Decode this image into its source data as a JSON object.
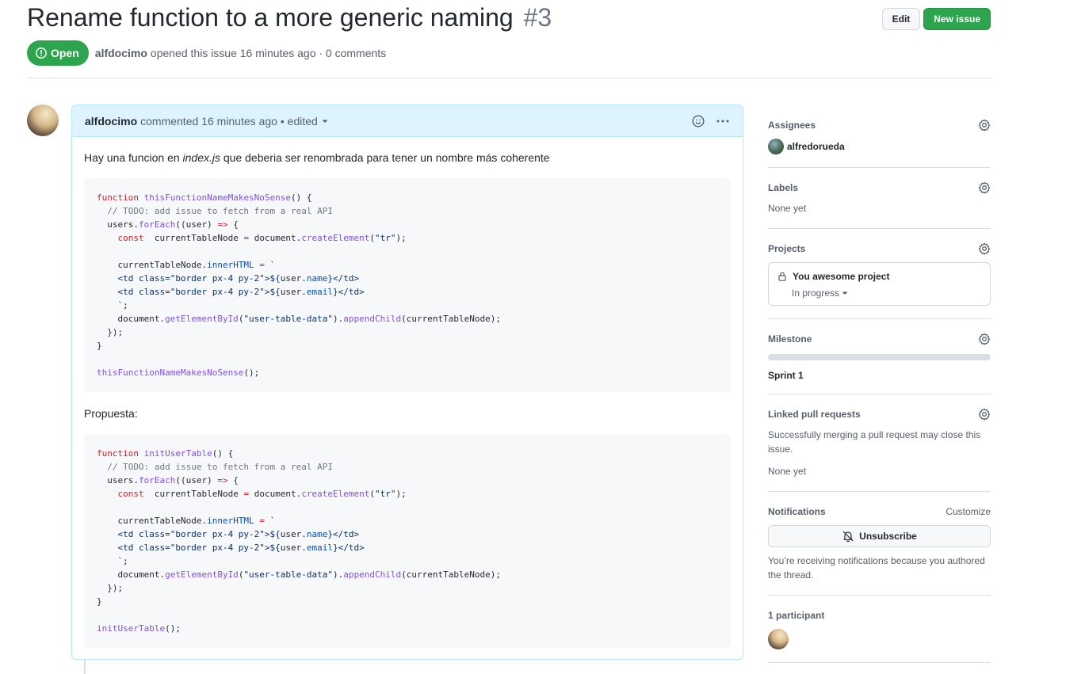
{
  "issue": {
    "title": "Rename function to a more generic naming",
    "number": "#3",
    "state": "Open",
    "author": "alfdocimo",
    "meta_text": "opened this issue 16 minutes ago · 0 comments"
  },
  "header_buttons": {
    "edit": "Edit",
    "new_issue": "New issue"
  },
  "comment": {
    "author": "alfdocimo",
    "meta": "commented 16 minutes ago",
    "edited": "• edited",
    "body_intro_1": "Hay una funcion en ",
    "body_intro_file": "index.js",
    "body_intro_2": " que deberia ser renombrada para tener un nombre más coherente",
    "proposal_label": "Propuesta:",
    "code1": [
      [
        [
          "k",
          "function "
        ],
        [
          "f",
          "thisFunctionNameMakesNoSense"
        ],
        [
          "",
          "() {"
        ]
      ],
      [
        [
          "c",
          "  // TODO: add issue to fetch from a real API"
        ]
      ],
      [
        [
          "",
          "  users."
        ],
        [
          "f",
          "forEach"
        ],
        [
          "",
          "((user) "
        ],
        [
          "k",
          "=>"
        ],
        [
          "",
          " {"
        ]
      ],
      [
        [
          "k",
          "    const "
        ],
        [
          "",
          " currentTableNode "
        ],
        [
          "k",
          "="
        ],
        [
          "",
          " document."
        ],
        [
          "f",
          "createElement"
        ],
        [
          "",
          "("
        ],
        [
          "s",
          "\"tr\""
        ],
        [
          "",
          ");"
        ]
      ],
      [
        [
          "",
          ""
        ]
      ],
      [
        [
          "",
          "    currentTableNode."
        ],
        [
          "p",
          "innerHTML"
        ],
        [
          "k",
          " = "
        ],
        [
          "s",
          "`"
        ]
      ],
      [
        [
          "s",
          "    <td class=\"border px-4 py-2\">${"
        ],
        [
          "",
          "user."
        ],
        [
          "p",
          "name"
        ],
        [
          "s",
          "}</td>"
        ]
      ],
      [
        [
          "s",
          "    <td class=\"border px-4 py-2\">${"
        ],
        [
          "",
          "user."
        ],
        [
          "p",
          "email"
        ],
        [
          "s",
          "}</td>"
        ]
      ],
      [
        [
          "s",
          "    `"
        ],
        [
          "",
          ";"
        ]
      ],
      [
        [
          "",
          "    document."
        ],
        [
          "f",
          "getElementById"
        ],
        [
          "",
          "("
        ],
        [
          "s",
          "\"user-table-data\""
        ],
        [
          "",
          ")."
        ],
        [
          "f",
          "appendChild"
        ],
        [
          "",
          "(currentTableNode);"
        ]
      ],
      [
        [
          "",
          "  });"
        ]
      ],
      [
        [
          "",
          "}"
        ]
      ],
      [
        [
          "",
          ""
        ]
      ],
      [
        [
          "f",
          "thisFunctionNameMakesNoSense"
        ],
        [
          "",
          "();"
        ]
      ]
    ],
    "code2": [
      [
        [
          "k",
          "function "
        ],
        [
          "f",
          "initUserTable"
        ],
        [
          "",
          "() {"
        ]
      ],
      [
        [
          "c",
          "  // TODO: add issue to fetch from a real API"
        ]
      ],
      [
        [
          "",
          "  users."
        ],
        [
          "f",
          "forEach"
        ],
        [
          "",
          "((user) "
        ],
        [
          "k",
          "=>"
        ],
        [
          "",
          " {"
        ]
      ],
      [
        [
          "k",
          "    const "
        ],
        [
          "",
          " currentTableNode "
        ],
        [
          "k",
          "="
        ],
        [
          "",
          " document."
        ],
        [
          "f",
          "createElement"
        ],
        [
          "",
          "("
        ],
        [
          "s",
          "\"tr\""
        ],
        [
          "",
          ");"
        ]
      ],
      [
        [
          "",
          ""
        ]
      ],
      [
        [
          "",
          "    currentTableNode."
        ],
        [
          "p",
          "innerHTML"
        ],
        [
          "k",
          " = "
        ],
        [
          "s",
          "`"
        ]
      ],
      [
        [
          "s",
          "    <td class=\"border px-4 py-2\">${"
        ],
        [
          "",
          "user."
        ],
        [
          "p",
          "name"
        ],
        [
          "s",
          "}</td>"
        ]
      ],
      [
        [
          "s",
          "    <td class=\"border px-4 py-2\">${"
        ],
        [
          "",
          "user."
        ],
        [
          "p",
          "email"
        ],
        [
          "s",
          "}</td>"
        ]
      ],
      [
        [
          "s",
          "    `"
        ],
        [
          "",
          ";"
        ]
      ],
      [
        [
          "",
          "    document."
        ],
        [
          "f",
          "getElementById"
        ],
        [
          "",
          "("
        ],
        [
          "s",
          "\"user-table-data\""
        ],
        [
          "",
          ")."
        ],
        [
          "f",
          "appendChild"
        ],
        [
          "",
          "(currentTableNode);"
        ]
      ],
      [
        [
          "",
          "  });"
        ]
      ],
      [
        [
          "",
          "}"
        ]
      ],
      [
        [
          "",
          ""
        ]
      ],
      [
        [
          "f",
          "initUserTable"
        ],
        [
          "",
          "();"
        ]
      ]
    ]
  },
  "sidebar": {
    "assignees": {
      "title": "Assignees",
      "user": "alfredorueda"
    },
    "labels": {
      "title": "Labels",
      "value": "None yet"
    },
    "projects": {
      "title": "Projects",
      "name": "You awesome project",
      "status": "In progress"
    },
    "milestone": {
      "title": "Milestone",
      "name": "Sprint 1",
      "progress": 0
    },
    "linked_prs": {
      "title": "Linked pull requests",
      "desc": "Successfully merging a pull request may close this issue.",
      "value": "None yet"
    },
    "notifications": {
      "title": "Notifications",
      "customize": "Customize",
      "button": "Unsubscribe",
      "desc": "You’re receiving notifications because you authored the thread."
    },
    "participants": {
      "title": "1 participant"
    }
  },
  "colors": {
    "open_green": "#2da44e",
    "comment_header": "#ddf4ff",
    "comment_border": "#b6e3ff"
  }
}
